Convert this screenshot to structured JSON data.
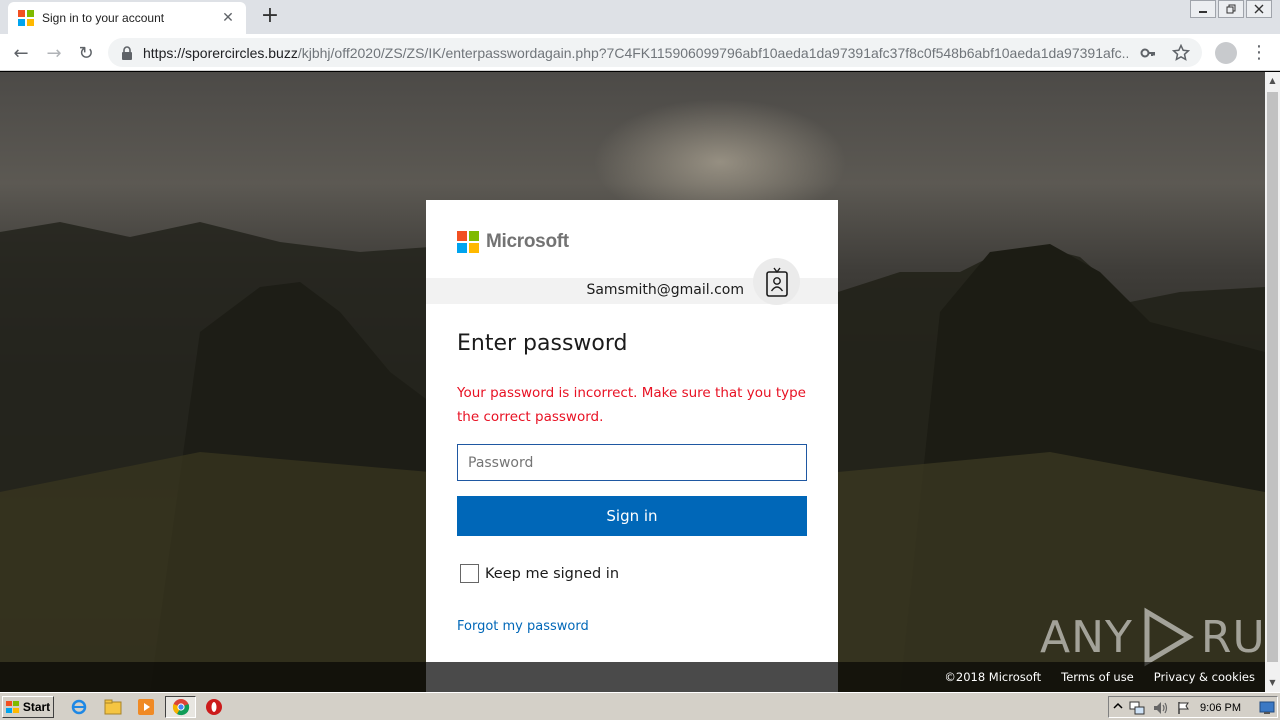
{
  "browser": {
    "tab_title": "Sign in to your account",
    "tab_close": "✕",
    "new_tab": "+",
    "url_host": "https://sporercircles.buzz",
    "url_path": "/kjbhj/off2020/ZS/ZS/IK/enterpasswordagain.php?7C4FK115906099796abf10aeda1da97391afc37f8c0f548b6abf10aeda1da97391afc...",
    "back": "←",
    "forward": "→",
    "reload": "↻",
    "key_icon": "key-icon",
    "star_icon": "star-icon",
    "menu": "⋮"
  },
  "card": {
    "brand": "Microsoft",
    "email": "Samsmith@gmail.com",
    "heading": "Enter password",
    "error": "Your password is incorrect. Make sure that you type the correct password.",
    "password_placeholder": "Password",
    "signin_label": "Sign in",
    "keep_signed_in": "Keep me signed in",
    "forgot_link": "Forgot my password"
  },
  "footer": {
    "copyright": "©2018 Microsoft",
    "terms": "Terms of use",
    "privacy": "Privacy & cookies"
  },
  "watermark": {
    "left": "ANY",
    "right": "RUN"
  },
  "taskbar": {
    "start_label": "Start",
    "clock": "9:06 PM"
  },
  "colors": {
    "ms_red": "#f25022",
    "ms_green": "#7fba00",
    "ms_blue": "#00a4ef",
    "ms_yellow": "#ffb900",
    "button_blue": "#0067b8",
    "error_red": "#e81123"
  }
}
